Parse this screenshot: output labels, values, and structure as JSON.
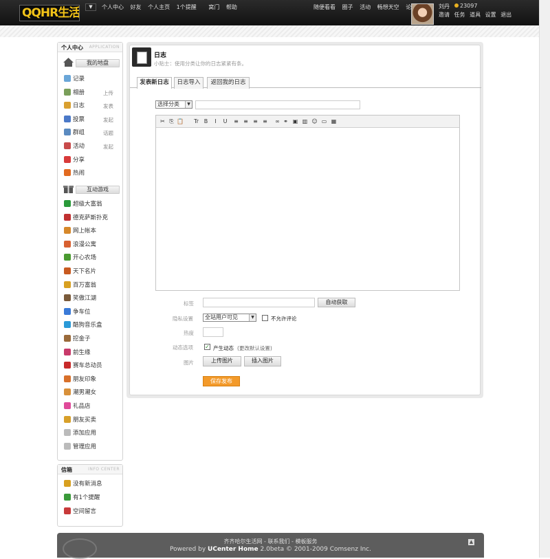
{
  "topbar": {
    "logo": "QQHR生活",
    "dropdown": "▼",
    "links": [
      "个人中心",
      "好友",
      "个人主页",
      "1个提醒",
      "窝门",
      "帮助"
    ],
    "right_links": [
      "随便看看",
      "圈子",
      "活动",
      "畅想天空",
      "论坛"
    ],
    "username": "刘丹",
    "coins": "23097",
    "user_links": [
      "邀请",
      "任务",
      "道具",
      "设置",
      "退出"
    ]
  },
  "sidebar": {
    "title": "个人中心",
    "title_en": "APPLICATION",
    "cat1": "我的地盘",
    "items1": [
      {
        "label": "记录",
        "action": "",
        "color": "#6aa6d8"
      },
      {
        "label": "相册",
        "action": "上传",
        "color": "#7a9f5a"
      },
      {
        "label": "日志",
        "action": "发表",
        "color": "#d9a030"
      },
      {
        "label": "投票",
        "action": "发起",
        "color": "#4b79c8"
      },
      {
        "label": "群组",
        "action": "话题",
        "color": "#5a8ac0"
      },
      {
        "label": "活动",
        "action": "发起",
        "color": "#c84b4b"
      },
      {
        "label": "分享",
        "action": "",
        "color": "#d83a3a"
      },
      {
        "label": "热闹",
        "action": "",
        "color": "#e26a20"
      }
    ],
    "cat2": "互动游戏",
    "items2": [
      {
        "label": "超级大富翁",
        "color": "#2a9a3a"
      },
      {
        "label": "德克萨斯扑克",
        "color": "#c03030"
      },
      {
        "label": "网上帐本",
        "color": "#d6882a"
      },
      {
        "label": "浪漫公寓",
        "color": "#d86030"
      },
      {
        "label": "开心农场",
        "color": "#4a9a30"
      },
      {
        "label": "天下名片",
        "color": "#c85a20"
      },
      {
        "label": "百万富翁",
        "color": "#d8a020"
      },
      {
        "label": "笑傲江湖",
        "color": "#7a5a3a"
      },
      {
        "label": "争车位",
        "color": "#3a7ad8"
      },
      {
        "label": "酷狗音乐盒",
        "color": "#2a9ad8"
      },
      {
        "label": "挖金子",
        "color": "#9a6a3a"
      },
      {
        "label": "前生缘",
        "color": "#c83a6a"
      },
      {
        "label": "赛车总动员",
        "color": "#c82a2a"
      },
      {
        "label": "朋友印象",
        "color": "#d8702a"
      },
      {
        "label": "潮男潮女",
        "color": "#d8903a"
      },
      {
        "label": "礼品店",
        "color": "#e04a9a"
      },
      {
        "label": "朋友买卖",
        "color": "#d8a02a"
      },
      {
        "label": "添加应用",
        "color": "#bbbbbb"
      },
      {
        "label": "管理应用",
        "color": "#bbbbbb"
      }
    ]
  },
  "inbox": {
    "title": "信箱",
    "title_en": "INFO CENTER",
    "items": [
      {
        "label": "没有新消息",
        "color": "#d8a020"
      },
      {
        "label": "有1个提醒",
        "color": "#3a9a3a"
      },
      {
        "label": "空间留言",
        "color": "#c83a3a"
      }
    ]
  },
  "page": {
    "title": "日志",
    "tip": "小贴士：使用分类让你的日志紧紧有条。"
  },
  "tabs": [
    "发表新日志",
    "日志导入",
    "返回我的日志"
  ],
  "form": {
    "category_select": "选择分类",
    "tags_label": "标签",
    "auto_fetch": "自动获取",
    "privacy_label": "隐私设置",
    "privacy_value": "全站用户可见",
    "no_comment": "不允许评论",
    "heat_label": "热度",
    "feed_label": "动态选项",
    "feed_option": "产生动态",
    "feed_note": "(更改默认设置)",
    "image_label": "图片",
    "upload_image": "上传图片",
    "insert_image": "插入图片",
    "save": "保存发布"
  },
  "editor": {
    "toolbar": [
      "✂",
      "⎘",
      "📋",
      "Tr",
      "B",
      "I",
      "U",
      "≡",
      "≡",
      "≡",
      "≡",
      "∞",
      "⚭",
      "▣",
      "▥",
      "☺",
      "▭",
      "▦"
    ]
  },
  "footer": {
    "line1": "齐齐哈尔生活网 - 联系我们 - 模板服务",
    "powered": "Powered by ",
    "product": "UCenter Home",
    "version": " 2.0beta © 2001-2009 Comsenz Inc."
  }
}
